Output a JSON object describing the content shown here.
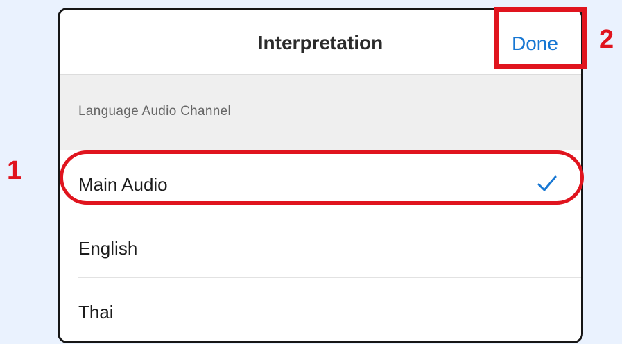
{
  "header": {
    "title": "Interpretation",
    "done_label": "Done"
  },
  "section": {
    "label": "Language Audio Channel"
  },
  "options": [
    {
      "label": "Main Audio",
      "selected": true
    },
    {
      "label": "English",
      "selected": false
    },
    {
      "label": "Thai",
      "selected": false
    }
  ],
  "annotations": {
    "step_1": "1",
    "step_2": "2"
  },
  "colors": {
    "background": "#eaf2fe",
    "accent_blue": "#1777d3",
    "annotation_red": "#e0141e",
    "section_gray": "#efefef"
  },
  "icons": {
    "selected_indicator": "checkmark-icon"
  }
}
